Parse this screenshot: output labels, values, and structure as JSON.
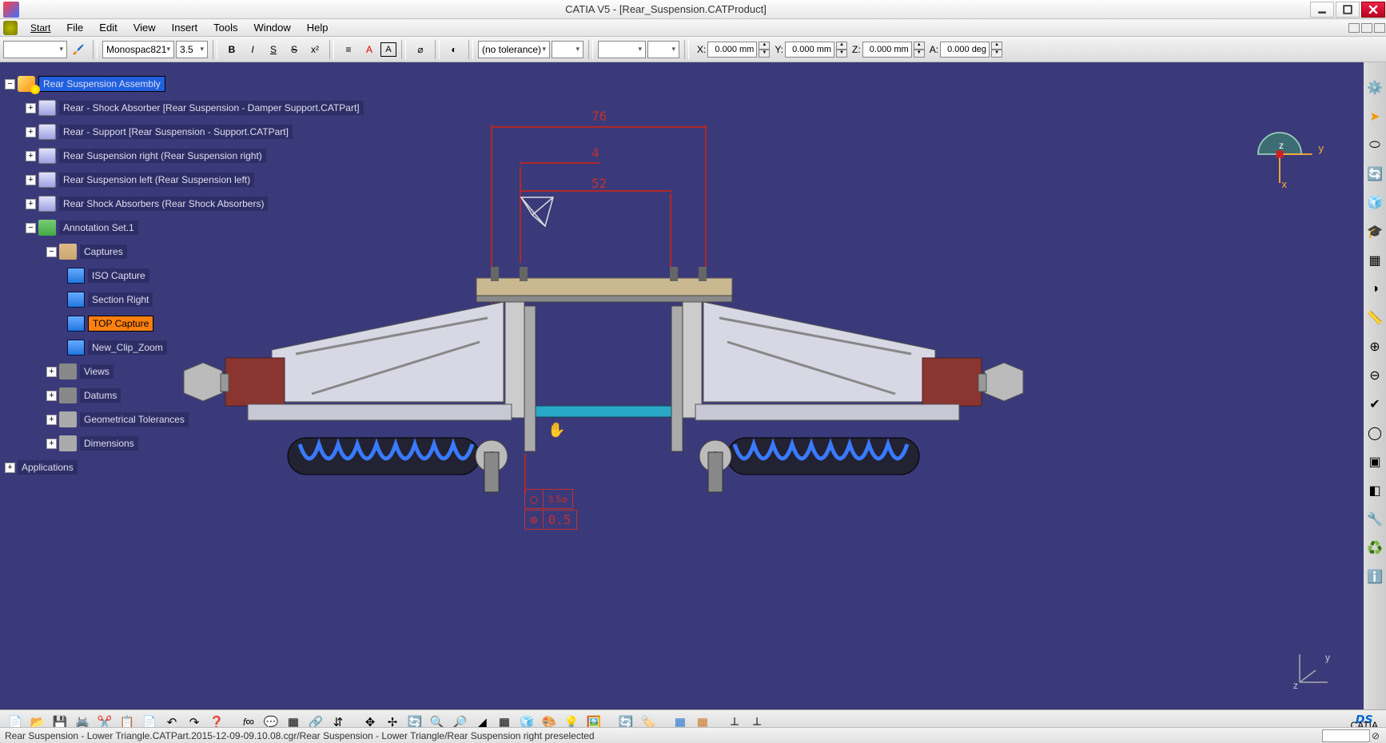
{
  "window": {
    "title": "CATIA V5 - [Rear_Suspension.CATProduct]"
  },
  "menus": [
    "Start",
    "File",
    "Edit",
    "View",
    "Insert",
    "Tools",
    "Window",
    "Help"
  ],
  "font": {
    "name": "Monospac821",
    "size": "3.5"
  },
  "tolerance": "(no tolerance)",
  "coords": {
    "xlabel": "X:",
    "x": "0.000 mm",
    "ylabel": "Y:",
    "y": "0.000 mm",
    "zlabel": "Z:",
    "z": "0.000 mm",
    "alabel": "A:",
    "a": "0.000 deg"
  },
  "tree": {
    "root": "Rear Suspension Assembly",
    "children": [
      "Rear - Shock Absorber [Rear Suspension - Damper Support.CATPart]",
      "Rear - Support [Rear Suspension - Support.CATPart]",
      "Rear Suspension right (Rear Suspension right)",
      "Rear Suspension left (Rear Suspension left)",
      "Rear Shock Absorbers (Rear Shock Absorbers)"
    ],
    "anno": "Annotation Set.1",
    "captures_label": "Captures",
    "captures": [
      "ISO Capture",
      "Section Right",
      "TOP Capture",
      "New_Clip_Zoom"
    ],
    "groups": [
      "Views",
      "Datums",
      "Geometrical Tolerances",
      "Dimensions"
    ],
    "applications": "Applications"
  },
  "dimensions": {
    "d1": "76",
    "d2": "4",
    "d3": "52"
  },
  "fcf": {
    "circ": "3.5",
    "pos": "0.5"
  },
  "compass": {
    "x": "x",
    "y": "y",
    "z": "z"
  },
  "status": "Rear Suspension - Lower Triangle.CATPart.2015-12-09-09.10.08.cgr/Rear Suspension - Lower Triangle/Rear Suspension right preselected"
}
